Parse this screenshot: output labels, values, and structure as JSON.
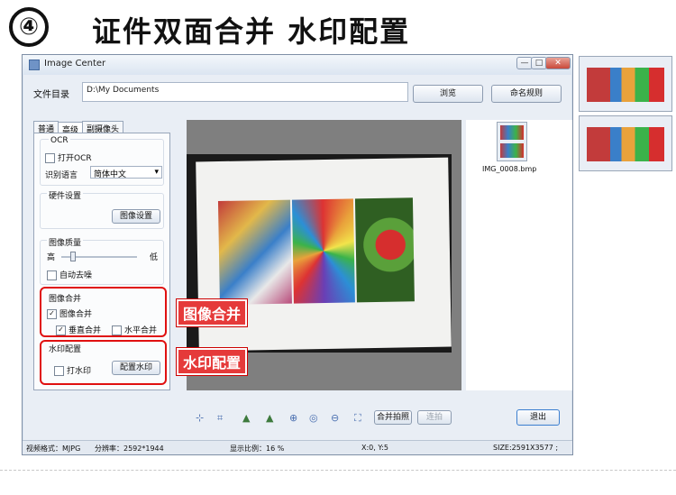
{
  "banner": {
    "number": "④",
    "title": "证件双面合并  水印配置"
  },
  "window": {
    "title": "Image Center",
    "controls": {
      "minimize": "—",
      "maximize": "□",
      "close": "✕"
    }
  },
  "file_dir": {
    "label": "文件目录",
    "value": "D:\\My Documents"
  },
  "buttons": {
    "browse": "浏览",
    "naming_rule": "命名规则"
  },
  "tabs": [
    "普通",
    "高级",
    "副摄像头"
  ],
  "ocr": {
    "title": "OCR",
    "enable_label": "打开OCR",
    "lang_label": "识别语言",
    "lang_value": "简体中文"
  },
  "hardware": {
    "title": "硬件设置",
    "button": "图像设置"
  },
  "quality": {
    "title": "图像质量",
    "high": "高",
    "low": "低",
    "denoise": "自动去噪"
  },
  "merge": {
    "title": "图像合并",
    "enable": "图像合并",
    "vertical": "垂直合并",
    "horizontal": "水平合并"
  },
  "watermark": {
    "title": "水印配置",
    "enable": "打水印",
    "button": "配置水印"
  },
  "callouts": {
    "merge": "图像合并",
    "watermark": "水印配置"
  },
  "thumbnail": {
    "filename": "IMG_0008.bmp"
  },
  "toolbar": {
    "merge_capture": "合并拍照",
    "continuous": "连拍",
    "exit": "退出",
    "icons": [
      "crop-icon",
      "rotate-left-icon",
      "rotate-right-icon",
      "zoom-in-icon",
      "zoom-fit-icon",
      "zoom-out-icon",
      "fullscreen-icon"
    ]
  },
  "status": {
    "format": "视频格式：MJPG",
    "resolution": "分辨率：2592*1944",
    "scale": "显示比例：16 %",
    "coords": "X:0, Y:5",
    "size": "SIZE:2591X3577 ;"
  },
  "colors": {
    "accent_red": "#e01010",
    "callout_red": "#e53a3a",
    "window_bg": "#e9eef5"
  }
}
